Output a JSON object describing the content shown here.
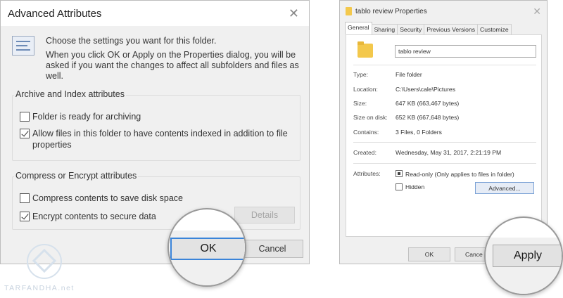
{
  "advanced_attributes": {
    "title": "Advanced Attributes",
    "intro_line1": "Choose the settings you want for this folder.",
    "intro_line2": "When you click OK or Apply on the Properties dialog, you will be asked if you want the changes to affect all subfolders and files as well.",
    "archive_group": {
      "label": "Archive and Index attributes",
      "archiving_label": "Folder is ready for archiving",
      "archiving_checked": false,
      "index_label": "Allow files in this folder to have contents indexed in addition to file properties",
      "index_checked": true
    },
    "compress_group": {
      "label": "Compress or Encrypt attributes",
      "compress_label": "Compress contents to save disk space",
      "compress_checked": false,
      "encrypt_label": "Encrypt contents to secure data",
      "encrypt_checked": true
    },
    "details_label": "Details",
    "ok_label": "OK",
    "cancel_label": "Cancel"
  },
  "properties": {
    "title": "tablo review Properties",
    "tabs": [
      "General",
      "Sharing",
      "Security",
      "Previous Versions",
      "Customize"
    ],
    "active_tab": "General",
    "folder_name": "tablo review",
    "type_label": "Type:",
    "type_value": "File folder",
    "location_label": "Location:",
    "location_value": "C:\\Users\\cale\\Pictures",
    "size_label": "Size:",
    "size_value": "647 KB (663,467 bytes)",
    "size_on_disk_label": "Size on disk:",
    "size_on_disk_value": "652 KB (667,648 bytes)",
    "contains_label": "Contains:",
    "contains_value": "3 Files, 0 Folders",
    "created_label": "Created:",
    "created_value": "Wednesday, May 31, 2017, 2:21:19 PM",
    "attributes_label": "Attributes:",
    "readonly_label": "Read-only (Only applies to files in folder)",
    "hidden_label": "Hidden",
    "advanced_label": "Advanced...",
    "ok_label": "OK",
    "cancel_label": "Cance",
    "apply_label": "Apply"
  },
  "watermark": {
    "text": "TARFANDHA.net"
  },
  "colors": {
    "focus_blue": "#3a84d9",
    "folder_yellow": "#f3c84c",
    "dialog_bg": "#f0f0f0"
  }
}
